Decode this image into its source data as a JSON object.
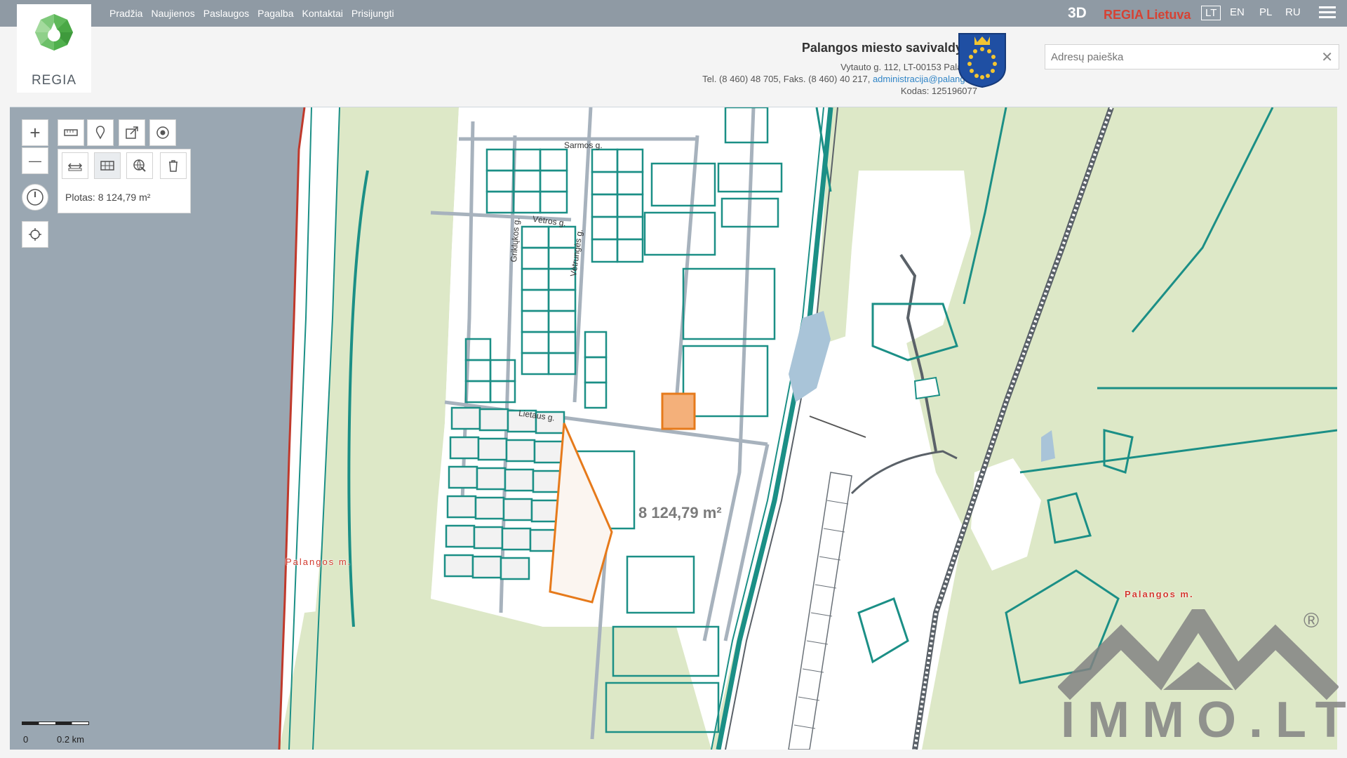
{
  "nav": {
    "items": [
      "Pradžia",
      "Naujienos",
      "Paslaugos",
      "Pagalba",
      "Kontaktai",
      "Prisijungti"
    ],
    "btn_3d": "3D",
    "regia_lt": "REGIA Lietuva",
    "languages": [
      "LT",
      "EN",
      "PL",
      "RU"
    ],
    "active_language": "LT"
  },
  "logo": {
    "text": "REGIA"
  },
  "municipality": {
    "name": "Palangos miesto savivaldybė",
    "address": "Vytauto g. 112, LT-00153 Palanga",
    "phone_prefix": "Tel. (8 460) 48 705, Faks. (8 460) 40 217, ",
    "email": "administracija@palanga.lt",
    "code": "Kodas: 125196077"
  },
  "search": {
    "placeholder": "Adresų paieška",
    "value": "",
    "clear": "✕"
  },
  "tools": {
    "zoom_in": "+",
    "zoom_out": "—",
    "area_readout": "Plotas: 8 124,79 m²"
  },
  "map": {
    "measured_area_label": "8 124,79 m²",
    "streets": [
      "Sarmos g.",
      "Vėtros g.",
      "Vėtrungės g.",
      "Lietaus g.",
      "Griklųkos g."
    ],
    "place_labels": [
      "Palangos m.",
      "Palangos m."
    ],
    "scale": {
      "start": "0",
      "end": "0.2 km"
    },
    "colors": {
      "parcel_line": "#1b8f86",
      "road": "#a7b2bd",
      "forest": "#dde8c7",
      "sea": "#9aa7b2",
      "selection": "#e67a1b",
      "boundary": "#c0392b"
    }
  },
  "watermark": {
    "text": "IMMO.LT",
    "reg": "®"
  }
}
